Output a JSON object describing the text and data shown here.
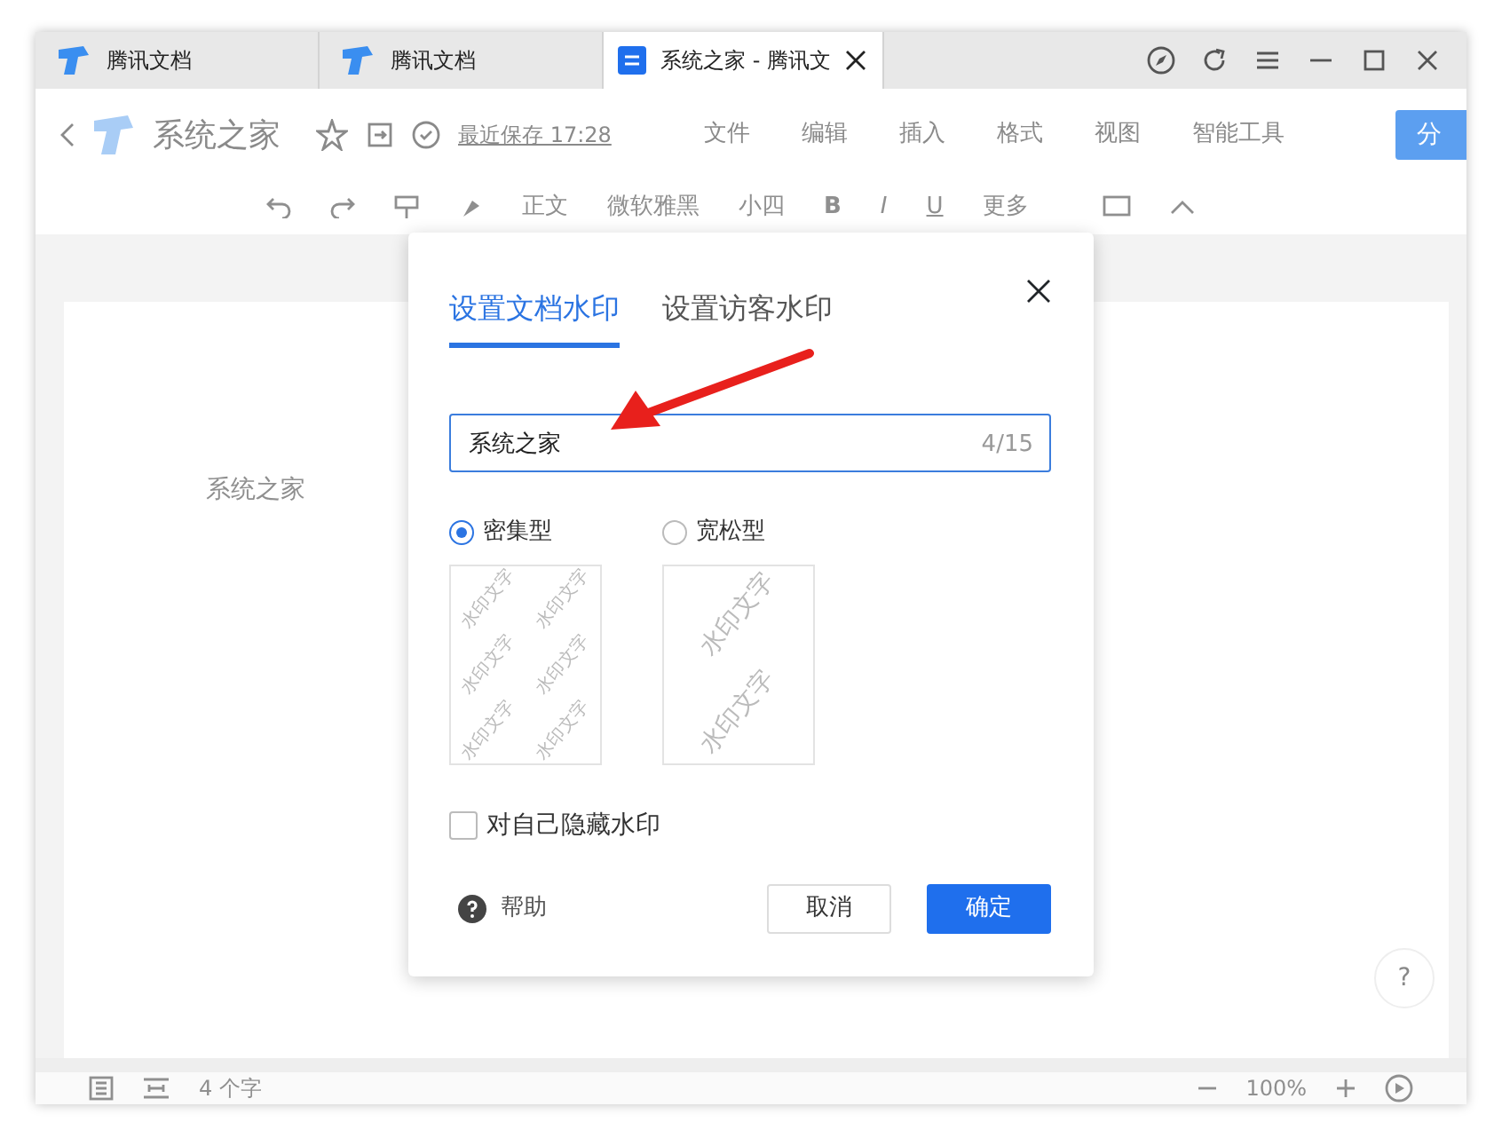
{
  "browser_tabs": [
    {
      "title": "腾讯文档",
      "selected": false
    },
    {
      "title": "腾讯文档",
      "selected": false
    },
    {
      "title": "系统之家 - 腾讯文",
      "selected": true
    }
  ],
  "header": {
    "doc_title": "系统之家",
    "save_status": "最近保存 17:28",
    "menus": [
      "文件",
      "编辑",
      "插入",
      "格式",
      "视图",
      "智能工具"
    ],
    "share_button": "分"
  },
  "toolbar": {
    "style": "正文",
    "font": "微软雅黑",
    "size": "小四",
    "bold": "B",
    "italic": "I",
    "underline": "U",
    "more": "更多"
  },
  "document": {
    "body": "系统之家",
    "help_button": "?"
  },
  "status_bar": {
    "word_count": "4 个字",
    "zoom": "100%"
  },
  "dialog": {
    "tabs": [
      {
        "label": "设置文档水印",
        "selected": true
      },
      {
        "label": "设置访客水印",
        "selected": false
      }
    ],
    "watermark_input": {
      "value": "系统之家",
      "counter": "4/15"
    },
    "density_options": [
      {
        "label": "密集型",
        "selected": true,
        "preview": [
          "水印文字",
          "水印文字",
          "水印文字",
          "水印文字",
          "水印文字",
          "水印文字"
        ]
      },
      {
        "label": "宽松型",
        "selected": false,
        "preview": [
          "水印文字",
          "水印文字"
        ]
      }
    ],
    "hide_for_self": {
      "label": "对自己隐藏水印",
      "checked": false
    },
    "help": "帮助",
    "cancel": "取消",
    "confirm": "确定"
  }
}
